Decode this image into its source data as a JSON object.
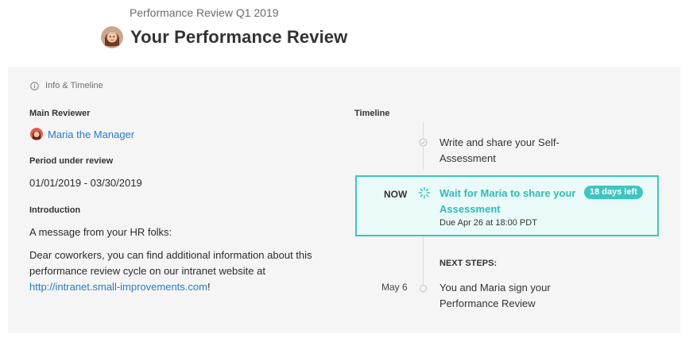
{
  "header": {
    "subtitle": "Performance Review Q1 2019",
    "title": "Your Performance Review"
  },
  "panel": {
    "section_title": "Info & Timeline",
    "main_reviewer_label": "Main Reviewer",
    "main_reviewer_name": "Maria the Manager",
    "period_label": "Period under review",
    "period_value": "01/01/2019 - 03/30/2019",
    "introduction_label": "Introduction",
    "intro_line1": "A message from your HR folks:",
    "intro_line2_part1": "Dear coworkers, you can find additional information about this performance review cycle on our intranet website at",
    "intro_link": "http://intranet.small-improvements.com",
    "intro_line2_end": "!"
  },
  "timeline": {
    "label": "Timeline",
    "step1": "Write and share your Self-Assessment",
    "now_label": "NOW",
    "now_title": "Wait for Maria to share your Assessment",
    "now_badge": "18 days left",
    "now_due": "Due Apr 26 at 18:00 PDT",
    "next_steps_label": "NEXT STEPS:",
    "next_date": "May 6",
    "next_step": "You and Maria sign your Performance Review"
  },
  "colors": {
    "accent": "#3fc4c0",
    "link": "#2a7ac7",
    "panel_bg": "#f5f5f5"
  },
  "icons": [
    "avatar",
    "info-icon",
    "check-icon",
    "spinner-icon",
    "circle-icon"
  ]
}
